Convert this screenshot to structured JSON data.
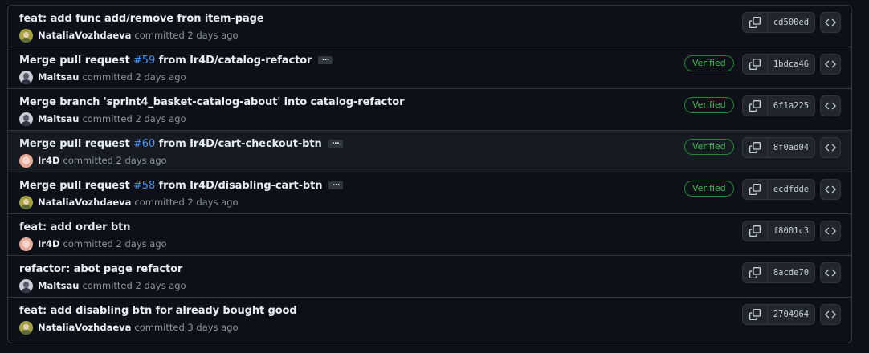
{
  "commits": [
    {
      "title": "feat: add func add/remove fron item-page",
      "author": "NataliaVozhdaeva",
      "avatar": "avatar-natalia",
      "committed": "committed 2 days ago",
      "verified": "",
      "sha": "cd500ed"
    },
    {
      "title_pre": "Merge pull request ",
      "pr": "#59",
      "title_post": " from Ir4D/catalog-refactor",
      "author": "Maltsau",
      "avatar": "avatar-maltsau",
      "committed": "committed 2 days ago",
      "verified": "Verified",
      "sha": "1bdca46"
    },
    {
      "title": "Merge branch 'sprint4_basket-catalog-about' into catalog-refactor",
      "author": "Maltsau",
      "avatar": "avatar-maltsau",
      "committed": "committed 2 days ago",
      "verified": "Verified",
      "sha": "6f1a225"
    },
    {
      "title_pre": "Merge pull request ",
      "pr": "#60",
      "title_post": " from Ir4D/cart-checkout-btn",
      "author": "Ir4D",
      "avatar": "avatar-ir4d",
      "committed": "committed 2 days ago",
      "verified": "Verified",
      "sha": "8f0ad04"
    },
    {
      "title_pre": "Merge pull request ",
      "pr": "#58",
      "title_post": " from Ir4D/disabling-cart-btn",
      "author": "NataliaVozhdaeva",
      "avatar": "avatar-natalia",
      "committed": "committed 2 days ago",
      "verified": "Verified",
      "sha": "ecdfdde"
    },
    {
      "title": "feat: add order btn",
      "author": "Ir4D",
      "avatar": "avatar-ir4d",
      "committed": "committed 2 days ago",
      "verified": "",
      "sha": "f8001c3"
    },
    {
      "title": "refactor: abot page refactor",
      "author": "Maltsau",
      "avatar": "avatar-maltsau",
      "committed": "committed 2 days ago",
      "verified": "",
      "sha": "8acde70"
    },
    {
      "title": "feat: add disabling btn for already bought good",
      "author": "NataliaVozhdaeva",
      "avatar": "avatar-natalia",
      "committed": "committed 3 days ago",
      "verified": "",
      "sha": "2704964"
    }
  ],
  "ellipsis_label": "…",
  "icons": {
    "copy": "copy-icon",
    "browse": "code-icon"
  },
  "colors": {
    "background": "#0d1117",
    "border": "#30363d",
    "link": "#4493f8",
    "verified": "#3fb950"
  }
}
